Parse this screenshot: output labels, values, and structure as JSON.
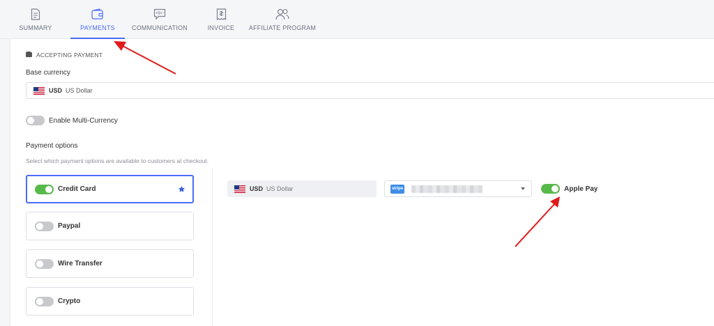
{
  "tabs": [
    {
      "label": "SUMMARY",
      "icon": "document-icon",
      "active": false
    },
    {
      "label": "PAYMENTS",
      "icon": "wallet-icon",
      "active": true
    },
    {
      "label": "COMMUNICATION",
      "icon": "chat-icon",
      "active": false
    },
    {
      "label": "INVOICE",
      "icon": "invoice-icon",
      "active": false
    },
    {
      "label": "AFFILIATE PROGRAM",
      "icon": "users-icon",
      "active": false
    }
  ],
  "section": {
    "title": "ACCEPTING PAYMENT",
    "icon": "wallet-icon"
  },
  "base_currency": {
    "label": "Base currency",
    "code": "USD",
    "name": "US Dollar",
    "flag": "us-flag-icon"
  },
  "multi_currency": {
    "label": "Enable Multi-Currency",
    "enabled": false
  },
  "payment_options": {
    "title": "Payment options",
    "hint": "Select which payment options are available to customers at checkout.",
    "items": [
      {
        "label": "Credit Card",
        "enabled": true,
        "selected": true,
        "starred": true
      },
      {
        "label": "Paypal",
        "enabled": false,
        "selected": false
      },
      {
        "label": "Wire Transfer",
        "enabled": false,
        "selected": false
      },
      {
        "label": "Crypto",
        "enabled": false,
        "selected": false
      }
    ]
  },
  "credit_card_config": {
    "currency_code": "USD",
    "currency_name": "US Dollar",
    "gateway_badge": "stripe",
    "apple_pay": {
      "label": "Apple Pay",
      "enabled": true
    }
  },
  "colors": {
    "accent": "#4a6cf7",
    "toggle_on": "#58b94b",
    "toggle_off": "#c8c9cc",
    "annotation_arrow": "#e01b1b"
  }
}
